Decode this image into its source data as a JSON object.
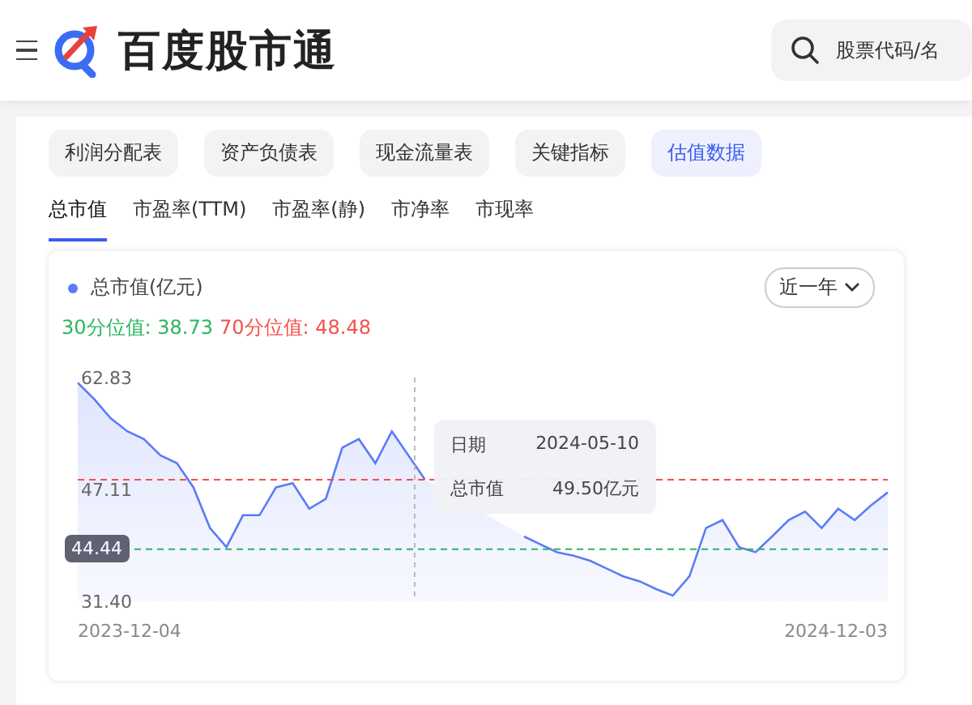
{
  "header": {
    "title": "百度股市通",
    "search": {
      "placeholder": "股票代码/名"
    }
  },
  "report_tabs": [
    {
      "label": "利润分配表",
      "selected": false
    },
    {
      "label": "资产负债表",
      "selected": false
    },
    {
      "label": "现金流量表",
      "selected": false
    },
    {
      "label": "关键指标",
      "selected": false
    },
    {
      "label": "估值数据",
      "selected": true
    }
  ],
  "metric_tabs": [
    {
      "label": "总市值",
      "selected": true
    },
    {
      "label": "市盈率(TTM)",
      "selected": false
    },
    {
      "label": "市盈率(静)",
      "selected": false
    },
    {
      "label": "市净率",
      "selected": false
    },
    {
      "label": "市现率",
      "selected": false
    }
  ],
  "chart_card": {
    "range_select": "近一年",
    "quantiles": [
      {
        "label": "30分位值:",
        "value": "38.73",
        "color": "#2db55d"
      },
      {
        "label": "70分位值:",
        "value": "48.48",
        "color": "#f5504a"
      }
    ],
    "cursor_label": "44.44",
    "tooltip": {
      "rows": [
        {
          "label": "日期",
          "value": "2024-05-10"
        },
        {
          "label": "总市值",
          "value": "49.50亿元"
        }
      ]
    },
    "x_axis_labels": [
      "2023-12-04",
      "2024-12-03"
    ],
    "chart_data": {
      "type": "area",
      "ylim": [
        31.4,
        62.83
      ],
      "yticks": [
        {
          "value": 31.4,
          "label": "31.40"
        },
        {
          "value": 47.11,
          "label": "47.11"
        },
        {
          "value": 62.83,
          "label": "62.83"
        }
      ],
      "ref_lines": [
        {
          "axis": "y",
          "value": 38.73,
          "color": "#2db55d"
        },
        {
          "axis": "y",
          "value": 48.48,
          "color": "#f5504a"
        }
      ],
      "series": [
        {
          "name": "总市值(亿元)",
          "color": "#5b7cf5",
          "values": [
            62.1,
            59.8,
            57.1,
            55.3,
            54.2,
            51.9,
            50.8,
            47.4,
            41.7,
            39.0,
            43.5,
            43.5,
            47.4,
            48.0,
            44.4,
            45.8,
            53.0,
            54.2,
            50.8,
            55.3,
            51.9,
            48.5,
            null,
            null,
            null,
            null,
            null,
            40.5,
            39.4,
            38.3,
            37.8,
            37.1,
            36.0,
            34.9,
            34.2,
            33.1,
            32.2,
            34.9,
            41.7,
            42.8,
            39.0,
            38.3,
            40.5,
            42.8,
            44.0,
            41.7,
            44.4,
            42.8,
            44.9,
            46.7
          ]
        }
      ]
    }
  }
}
